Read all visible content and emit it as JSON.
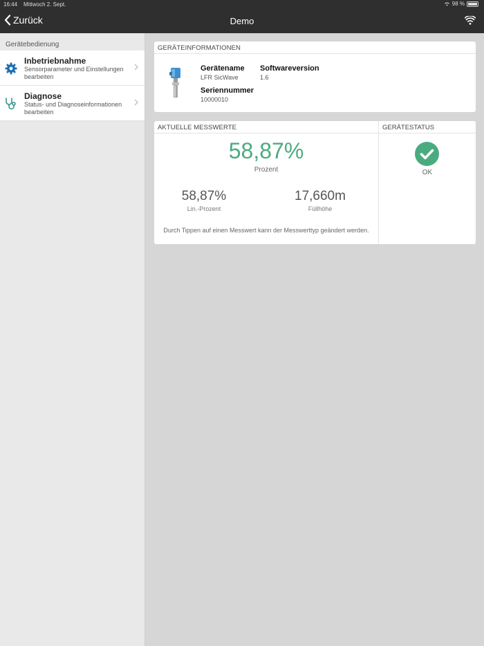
{
  "status_bar": {
    "time": "16:44",
    "date": "Mittwoch 2. Sept.",
    "battery": "98 %"
  },
  "nav": {
    "back_label": "Zurück",
    "title": "Demo"
  },
  "sidebar": {
    "header": "Gerätebedienung",
    "items": [
      {
        "title": "Inbetriebnahme",
        "subtitle": "Sensorparameter und Einstellungen bearbeiten",
        "icon": "gear-icon"
      },
      {
        "title": "Diagnose",
        "subtitle": "Status- und Diagnoseinformationen bearbeiten",
        "icon": "stethoscope-icon"
      }
    ]
  },
  "device_info": {
    "header": "GERÄTEINFORMATIONEN",
    "name_label": "Gerätename",
    "name_value": "LFR SicWave",
    "software_label": "Softwareversion",
    "software_value": "1.6",
    "serial_label": "Seriennummer",
    "serial_value": "10000010"
  },
  "measurements": {
    "header": "AKTUELLE MESSWERTE",
    "primary_value": "58,87%",
    "primary_unit": "Prozent",
    "secondary": [
      {
        "value": "58,87%",
        "unit": "Lin.-Prozent"
      },
      {
        "value": "17,660m",
        "unit": "Füllhöhe"
      }
    ],
    "hint": "Durch Tippen auf einen Messwert kann der Messwerttyp geändert werden."
  },
  "device_status": {
    "header": "GERÄTESTATUS",
    "value": "OK",
    "icon": "checkmark-circle-icon"
  },
  "colors": {
    "accent": "#4bab80",
    "icon_blue": "#1f6fb2",
    "icon_teal": "#2b8f86",
    "nav_bg": "#2f2f2f"
  }
}
